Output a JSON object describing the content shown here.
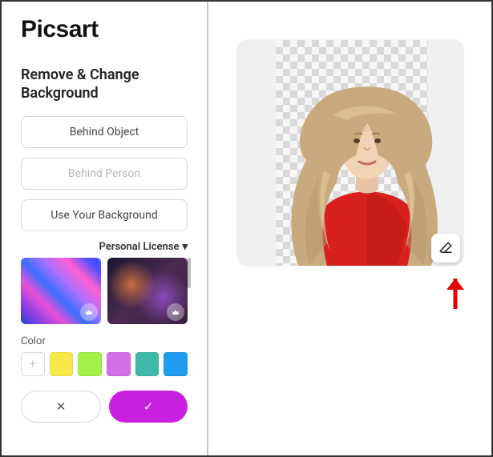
{
  "app": {
    "logo": "Picsart"
  },
  "sidebar": {
    "section_title": "Remove & Change Background",
    "buttons": {
      "behind_object": "Behind Object",
      "behind_person": "Behind Person",
      "use_your_bg": "Use Your Background"
    },
    "license_label": "Personal License",
    "color_label": "Color",
    "swatches": {
      "add": "+",
      "c1": "#f7e84a",
      "c2": "#a3f24a",
      "c3": "#d36fe6",
      "c4": "#3eb8a8",
      "c5": "#1f9bf0"
    },
    "actions": {
      "cancel": "✕",
      "confirm": "✓"
    }
  },
  "canvas": {
    "eraser_icon": "eraser"
  },
  "icons": {
    "chevron_down": "▾"
  }
}
